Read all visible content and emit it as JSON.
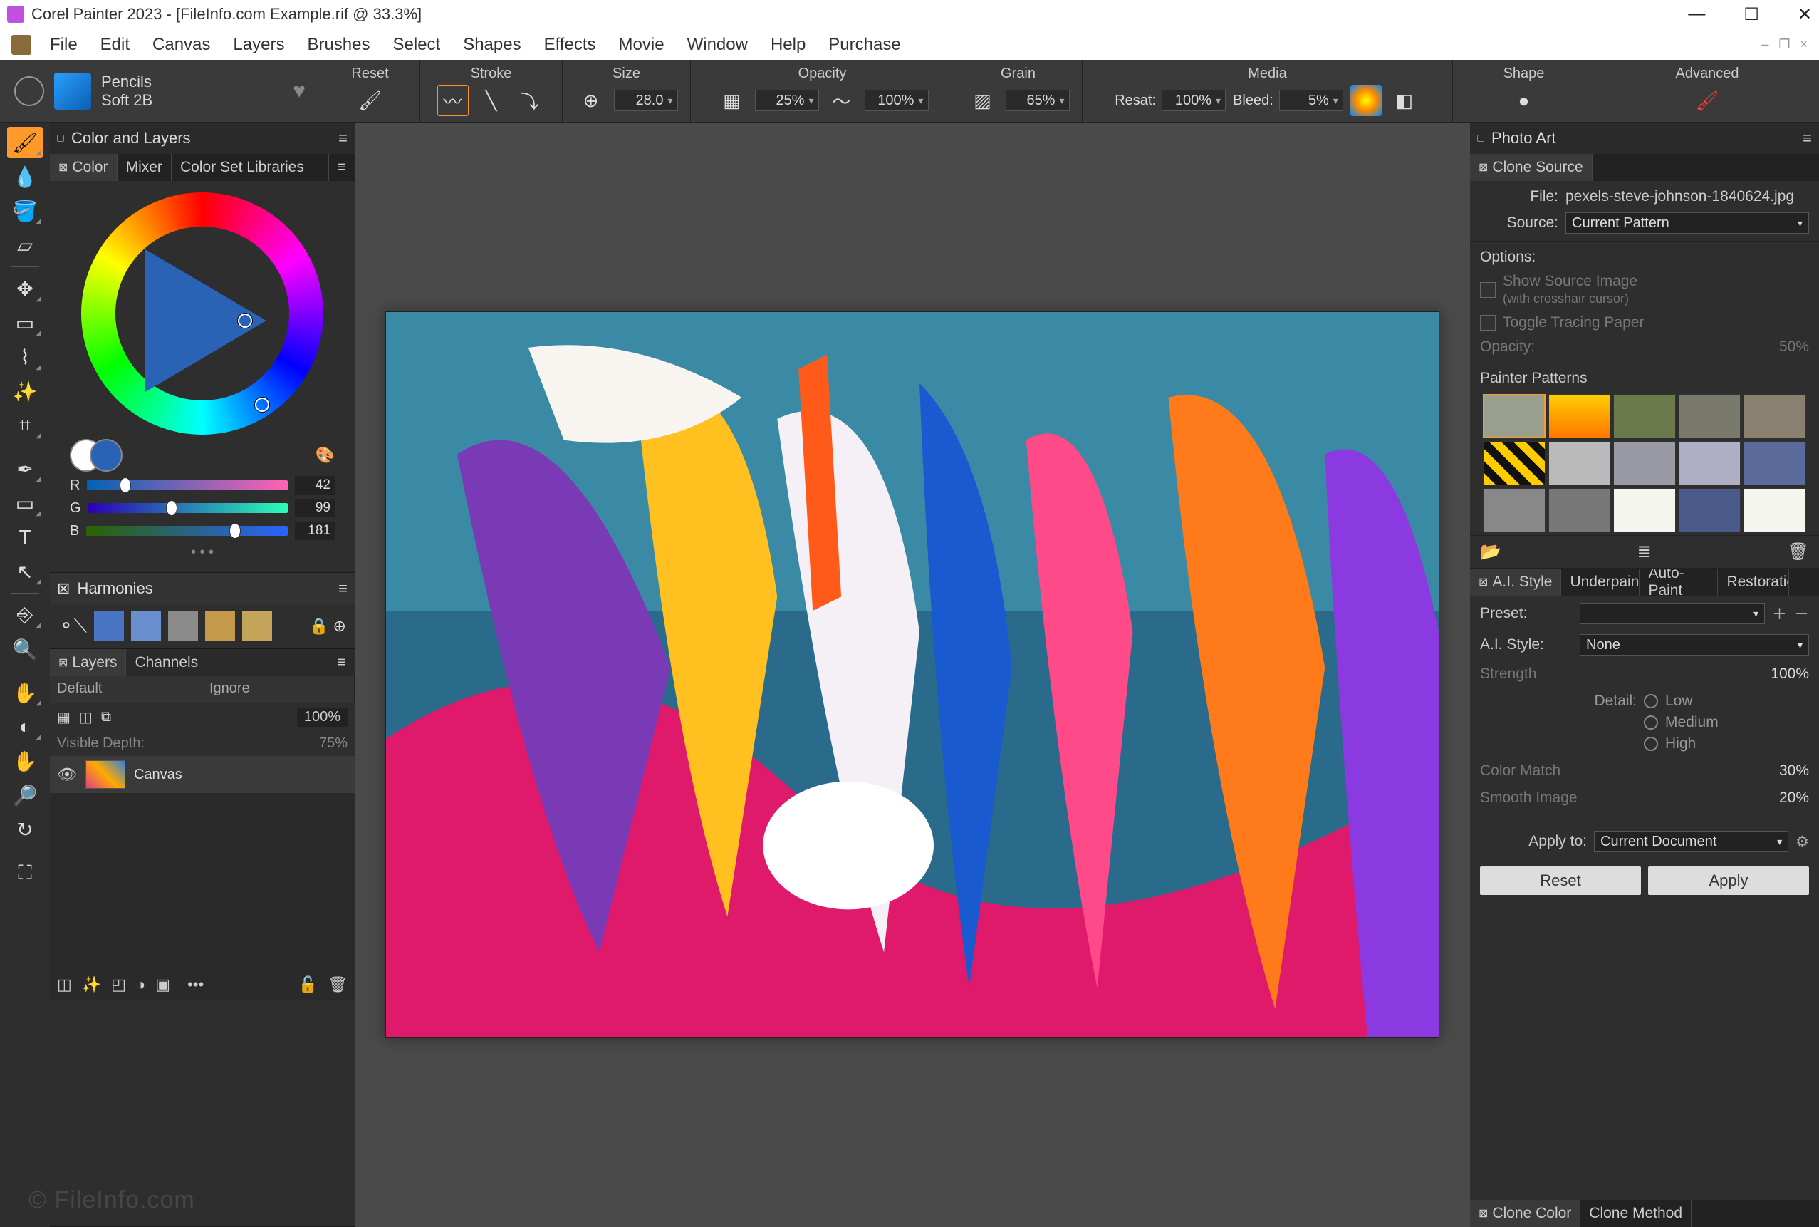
{
  "title": "Corel Painter 2023 - [FileInfo.com Example.rif @ 33.3%]",
  "menus": [
    "File",
    "Edit",
    "Canvas",
    "Layers",
    "Brushes",
    "Select",
    "Shapes",
    "Effects",
    "Movie",
    "Window",
    "Help",
    "Purchase"
  ],
  "brush": {
    "category": "Pencils",
    "name": "Soft 2B"
  },
  "prop": {
    "reset": "Reset",
    "stroke": "Stroke",
    "size": "Size",
    "size_val": "28.0",
    "opacity": "Opacity",
    "opacity_val": "25%",
    "grain": "Grain",
    "grain_val": "65%",
    "media": "Media",
    "resat": "Resat:",
    "resat_val": "100%",
    "bleed": "Bleed:",
    "bleed_val": "5%",
    "shape": "Shape",
    "advanced": "Advanced",
    "hundred": "100%"
  },
  "tools": [
    "brush",
    "dropper",
    "paintbucket",
    "eraser",
    "move",
    "rect-select",
    "lasso",
    "wand",
    "crop",
    "pen",
    "rect-shape",
    "text",
    "pointer",
    "clone",
    "zoom",
    "hand-adjust",
    "dodge",
    "pan",
    "rotate",
    "reset-rotate",
    "screen-toggle"
  ],
  "colorpanel": {
    "title": "Color and Layers",
    "tabs": [
      "Color",
      "Mixer",
      "Color Set Libraries"
    ],
    "rgb": {
      "r": 42,
      "g": 99,
      "b": 181
    }
  },
  "harmonies": {
    "title": "Harmonies",
    "colors": [
      "#4a75c4",
      "#6a8fce",
      "#8a8a8a",
      "#c49a4a",
      "#c4a45a"
    ]
  },
  "layers": {
    "title": "Layers",
    "tabs": [
      "Layers",
      "Channels"
    ],
    "blend": "Default",
    "mask": "Ignore",
    "opacity": "100%",
    "vdepth_lab": "Visible Depth:",
    "vdepth": "75%",
    "canvas": "Canvas"
  },
  "photo": {
    "title": "Photo Art",
    "clonetab": "Clone Source",
    "file_lab": "File:",
    "file": "pexels-steve-johnson-1840624.jpg",
    "source_lab": "Source:",
    "source": "Current Pattern",
    "options": "Options:",
    "show_src": "Show Source Image",
    "show_src2": "(with crosshair cursor)",
    "tracing": "Toggle Tracing Paper",
    "opac_lab": "Opacity:",
    "opac": "50%",
    "patterns_lab": "Painter Patterns"
  },
  "ai": {
    "tabs": [
      "A.I. Style",
      "Underpainting",
      "Auto-Paint",
      "Restoration"
    ],
    "preset": "Preset:",
    "style_lab": "A.I. Style:",
    "style": "None",
    "strength": "Strength",
    "strength_v": "100%",
    "detail": "Detail:",
    "low": "Low",
    "med": "Medium",
    "high": "High",
    "colormatch": "Color Match",
    "colormatch_v": "30%",
    "smooth": "Smooth Image",
    "smooth_v": "20%",
    "apply_lab": "Apply to:",
    "apply_to": "Current Document",
    "reset": "Reset",
    "apply": "Apply"
  },
  "clone": {
    "tabs": [
      "Clone Color",
      "Clone Method"
    ]
  },
  "watermark": "© FileInfo.com"
}
